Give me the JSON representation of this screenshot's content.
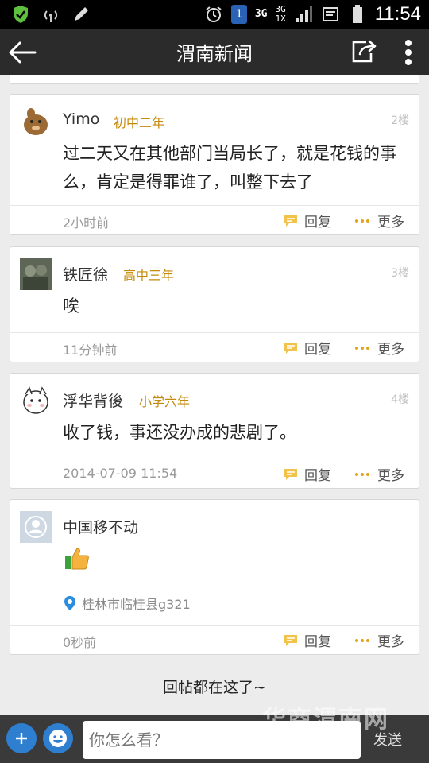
{
  "status_bar": {
    "network_left": "3G",
    "network_right": "3G",
    "network_sub": "1X",
    "sim": "1",
    "time": "11:54"
  },
  "app_bar": {
    "title": "渭南新闻"
  },
  "comments": [
    {
      "name": "Yimo",
      "level": "初中二年",
      "floor": "2楼",
      "content": "过二天又在其他部门当局长了，就是花钱的事么，肯定是得罪谁了，叫整下去了",
      "time": "2小时前",
      "reply": "回复",
      "more": "更多"
    },
    {
      "name": "铁匠徐",
      "level": "高中三年",
      "floor": "3楼",
      "content": "唉",
      "time": "11分钟前",
      "reply": "回复",
      "more": "更多"
    },
    {
      "name": "浮华背後",
      "level": "小学六年",
      "floor": "4楼",
      "content": "收了钱，事还没办成的悲剧了。",
      "time": "2014-07-09 11:54",
      "reply": "回复",
      "more": "更多"
    },
    {
      "name": "中国移不动",
      "location": "桂林市临桂县g321",
      "time": "0秒前",
      "reply": "回复",
      "more": "更多"
    }
  ],
  "end_text": "回帖都在这了~",
  "input_bar": {
    "placeholder": "你怎么看？",
    "send": "发送"
  },
  "watermark": "华商渭南网",
  "colors": {
    "level": "#c58a0a",
    "appbar": "#2b2b2b",
    "accent_blue": "#2f7fd0"
  }
}
